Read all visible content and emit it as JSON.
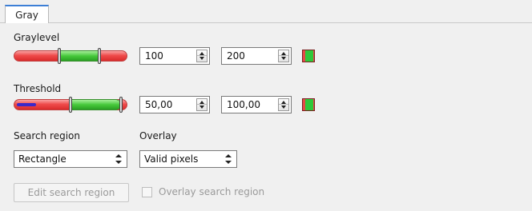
{
  "tabs": [
    {
      "label": "Gray"
    }
  ],
  "graylevel": {
    "label": "Graylevel",
    "min_value": "100",
    "max_value": "200",
    "range_low": 100,
    "range_high": 200,
    "range_max": 255
  },
  "threshold": {
    "label": "Threshold",
    "min_value": "50,00",
    "max_value": "100,00",
    "range_low": 50,
    "range_high": 100,
    "range_max": 100
  },
  "search_region": {
    "label": "Search region",
    "selected": "Rectangle"
  },
  "overlay": {
    "label": "Overlay",
    "selected": "Valid pixels"
  },
  "edit_search_region_button": "Edit search region",
  "overlay_search_region_checkbox": {
    "label": "Overlay search region",
    "checked": false,
    "enabled": false
  },
  "colors": {
    "slider_red": "#ef4b4b",
    "slider_green": "#46c83b",
    "threshold_indicator": "#3b28c9",
    "tab_accent": "#3c7fd6"
  }
}
